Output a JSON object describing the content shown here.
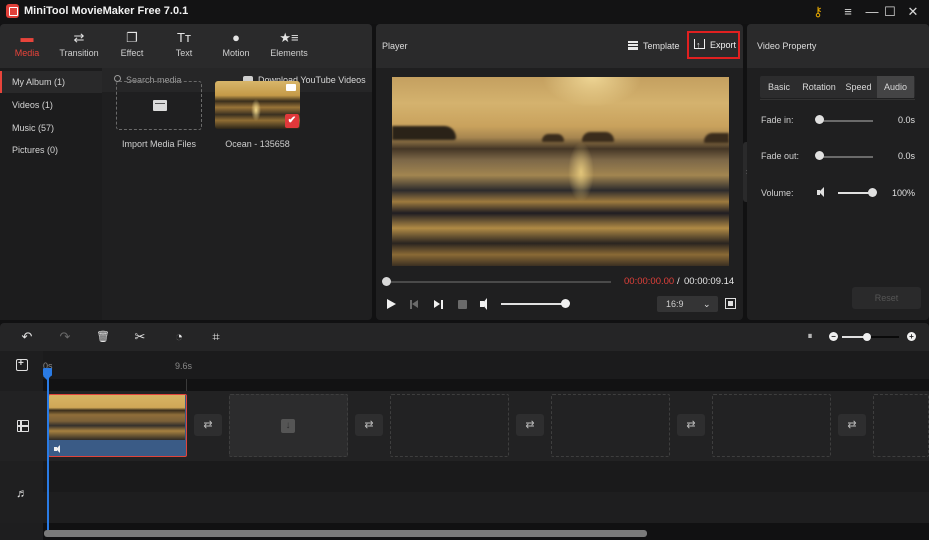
{
  "titlebar": {
    "title": "MiniTool MovieMaker Free 7.0.1",
    "key_icon": "key-icon",
    "menu_icon": "hamburger-menu-icon",
    "minimize_glyph": "—",
    "maximize_glyph": "☐",
    "close_glyph": "✕"
  },
  "media_tabs": [
    {
      "label": "Media",
      "icon": "folder-icon",
      "glyph": "▬",
      "active": true
    },
    {
      "label": "Transition",
      "icon": "swap-arrows-icon",
      "glyph": "⇄",
      "active": false
    },
    {
      "label": "Effect",
      "icon": "effect-squares-icon",
      "glyph": "❐",
      "active": false
    },
    {
      "label": "Text",
      "icon": "text-icon",
      "glyph": "Tт",
      "active": false
    },
    {
      "label": "Motion",
      "icon": "motion-ball-icon",
      "glyph": "●",
      "active": false
    },
    {
      "label": "Elements",
      "icon": "elements-star-icon",
      "glyph": "★≡",
      "active": false
    }
  ],
  "album": {
    "items": [
      {
        "label": "My Album (1)",
        "active": true
      },
      {
        "label": "Videos (1)",
        "active": false
      },
      {
        "label": "Music (57)",
        "active": false
      },
      {
        "label": "Pictures (0)",
        "active": false
      }
    ]
  },
  "media_search": {
    "placeholder": "Search media",
    "download_label": "Download YouTube Videos"
  },
  "media_items": {
    "import_label": "Import Media Files",
    "ocean_label": "Ocean - 135658",
    "ocean_checked": "✔"
  },
  "player": {
    "title": "Player",
    "template_label": "Template",
    "export_label": "Export",
    "time_current": "00:00:00.00",
    "time_separator": "/",
    "time_total": "00:00:09.14",
    "seek_progress": 0,
    "volume_level": 1.0,
    "aspect_ratio": "16:9",
    "chevron": "⌄"
  },
  "video_property": {
    "title": "Video Property",
    "tabs": [
      {
        "label": "Basic",
        "active": false
      },
      {
        "label": "Rotation",
        "active": false
      },
      {
        "label": "Speed",
        "active": false
      },
      {
        "label": "Audio",
        "active": true
      }
    ],
    "fade_in_label": "Fade in:",
    "fade_in_value": "0.0s",
    "fade_out_label": "Fade out:",
    "fade_out_value": "0.0s",
    "volume_label": "Volume:",
    "volume_value": "100%",
    "reset_label": "Reset",
    "collapse_glyph": "›"
  },
  "timeline": {
    "toolbar": {
      "undo_glyph": "↶",
      "redo_glyph": "↷",
      "delete_glyph": "🗑",
      "split_glyph": "✂",
      "speed_glyph": "◔",
      "crop_glyph": "⌗",
      "fit_glyph": "⏸",
      "zoom_out_glyph": "−",
      "zoom_in_glyph": "+",
      "zoom_level": 0.4
    },
    "ruler": {
      "start_label": "0s",
      "mark_label": "9.6s"
    },
    "transition_glyph": "⇄",
    "drop_glyph": "↓",
    "music_glyph": "♬"
  }
}
